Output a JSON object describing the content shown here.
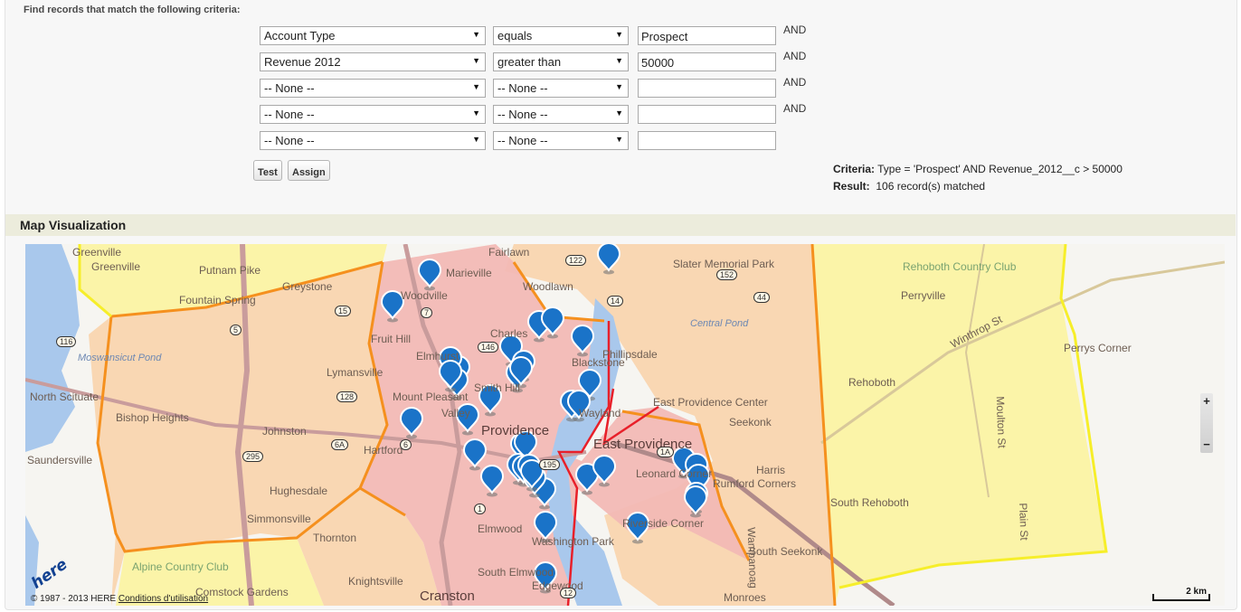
{
  "criteria_panel": {
    "intro": "Find records that match the following criteria:",
    "rows": [
      {
        "field": "Account Type",
        "operator": "equals",
        "value": "Prospect",
        "connector": "AND"
      },
      {
        "field": "Revenue 2012",
        "operator": "greater than",
        "value": "50000",
        "connector": "AND"
      },
      {
        "field": "-- None --",
        "operator": "-- None --",
        "value": "",
        "connector": "AND"
      },
      {
        "field": "-- None --",
        "operator": "-- None --",
        "value": "",
        "connector": "AND"
      },
      {
        "field": "-- None --",
        "operator": "-- None --",
        "value": "",
        "connector": ""
      }
    ],
    "dropdown_arrow": "▼",
    "buttons": {
      "test": "Test",
      "assign": "Assign"
    },
    "summary": {
      "criteria_label": "Criteria:",
      "criteria_value": "Type = 'Prospect' AND Revenue_2012__c > 50000",
      "result_label": "Result:",
      "result_value": "106 record(s) matched"
    }
  },
  "map_section": {
    "title": "Map Visualization",
    "zoom_in": "+",
    "zoom_out": "−",
    "scale_label": "2 km",
    "logo": "here",
    "copyright": "© 1987 - 2013 HERE",
    "terms_link": "Conditions d'utilisation",
    "colors": {
      "marker": "#1a73c8",
      "zone_high": "#f2b9b5",
      "zone_mid": "#f9d7b3",
      "zone_low": "#fbf4a8",
      "border_red": "#e8202a",
      "border_orange": "#f5901e",
      "border_yellow": "#f6ee2a",
      "water": "#a9c8ec"
    },
    "places": [
      {
        "name": "Greenville",
        "cls": ""
      },
      {
        "name": "Greenville",
        "cls": ""
      },
      {
        "name": "Putnam Pike",
        "cls": ""
      },
      {
        "name": "Greystone",
        "cls": ""
      },
      {
        "name": "Fountain Spring",
        "cls": ""
      },
      {
        "name": "Marieville",
        "cls": ""
      },
      {
        "name": "Woodville",
        "cls": ""
      },
      {
        "name": "Fairlawn",
        "cls": ""
      },
      {
        "name": "Woodlawn",
        "cls": ""
      },
      {
        "name": "Slater Memorial Park",
        "cls": ""
      },
      {
        "name": "Central Pond",
        "cls": "water"
      },
      {
        "name": "Rehoboth Country Club",
        "cls": "green"
      },
      {
        "name": "Perryville",
        "cls": ""
      },
      {
        "name": "Perrys Corner",
        "cls": ""
      },
      {
        "name": "Moswansicut Pond",
        "cls": "water"
      },
      {
        "name": "Fruit Hill",
        "cls": ""
      },
      {
        "name": "Charles",
        "cls": ""
      },
      {
        "name": "Lymansville",
        "cls": ""
      },
      {
        "name": "Elmhurst",
        "cls": ""
      },
      {
        "name": "Blackstone",
        "cls": ""
      },
      {
        "name": "Phillipsdale",
        "cls": ""
      },
      {
        "name": "Smith Hill",
        "cls": ""
      },
      {
        "name": "North Scituate",
        "cls": ""
      },
      {
        "name": "Mount Pleasant",
        "cls": ""
      },
      {
        "name": "East Providence Center",
        "cls": ""
      },
      {
        "name": "Rehoboth",
        "cls": ""
      },
      {
        "name": "Bishop Heights",
        "cls": ""
      },
      {
        "name": "Valley",
        "cls": ""
      },
      {
        "name": "Wayland",
        "cls": ""
      },
      {
        "name": "Seekonk",
        "cls": ""
      },
      {
        "name": "Johnston",
        "cls": ""
      },
      {
        "name": "Providence",
        "cls": "big"
      },
      {
        "name": "Hartford",
        "cls": ""
      },
      {
        "name": "East Providence",
        "cls": "big"
      },
      {
        "name": "Saundersville",
        "cls": ""
      },
      {
        "name": "Hughesdale",
        "cls": ""
      },
      {
        "name": "Leonard Corner",
        "cls": ""
      },
      {
        "name": "Rumford Corners",
        "cls": ""
      },
      {
        "name": "Harris",
        "cls": ""
      },
      {
        "name": "South Rehoboth",
        "cls": ""
      },
      {
        "name": "Simmonsville",
        "cls": ""
      },
      {
        "name": "Elmwood",
        "cls": ""
      },
      {
        "name": "Thornton",
        "cls": ""
      },
      {
        "name": "Washington Park",
        "cls": ""
      },
      {
        "name": "Riverside Corner",
        "cls": ""
      },
      {
        "name": "South Seekonk",
        "cls": ""
      },
      {
        "name": "Alpine Country Club",
        "cls": "green"
      },
      {
        "name": "Knightsville",
        "cls": ""
      },
      {
        "name": "South Elmwood",
        "cls": ""
      },
      {
        "name": "Edgewood",
        "cls": ""
      },
      {
        "name": "Comstock Gardens",
        "cls": ""
      },
      {
        "name": "Cranston",
        "cls": "big"
      },
      {
        "name": "Monroes",
        "cls": ""
      },
      {
        "name": "Winthrop St",
        "cls": ""
      },
      {
        "name": "Moulton St",
        "cls": ""
      },
      {
        "name": "Plain St",
        "cls": ""
      },
      {
        "name": "Wampanoag",
        "cls": ""
      }
    ],
    "route_shields": [
      "122",
      "152",
      "15",
      "7",
      "14",
      "146",
      "116",
      "5",
      "128",
      "44",
      "6A",
      "6",
      "1A",
      "295",
      "1",
      "12",
      "195"
    ],
    "marker_count": 40
  }
}
